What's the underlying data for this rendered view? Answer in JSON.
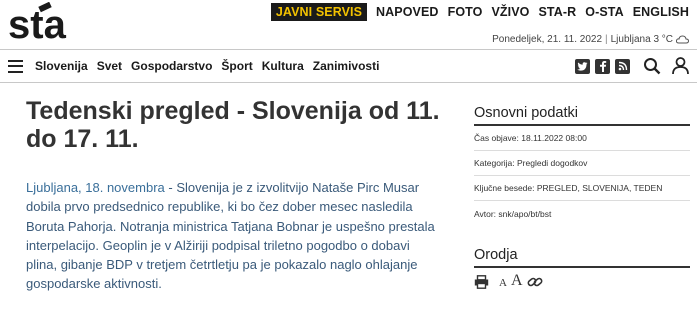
{
  "header": {
    "logo_text": "sta",
    "top_nav": [
      "JAVNI SERVIS",
      "NAPOVED",
      "FOTO",
      "VŽIVO",
      "STA-R",
      "O-STA",
      "ENGLISH"
    ],
    "date": "Ponedeljek, 21. 11. 2022",
    "weather": "Ljubljana 3 °C",
    "weather_icon": "cloud-icon"
  },
  "nav": {
    "items": [
      "Slovenija",
      "Svet",
      "Gospodarstvo",
      "Šport",
      "Kultura",
      "Zanimivosti"
    ],
    "icons": [
      "twitter-icon",
      "facebook-icon",
      "rss-icon",
      "search-icon",
      "user-icon"
    ]
  },
  "article": {
    "title": "Tedenski pregled - Slovenija od 11. do 17. 11.",
    "dateline": "Ljubljana, 18. novembra",
    "lead": " - Slovenija je z izvolitvijo Nataše Pirc Musar dobila prvo predsednico republike, ki bo čez dober mesec nasledila Boruta Pahorja. Notranja ministrica Tatjana Bobnar je uspešno prestala interpelacijo. Geoplin je v Alžiriji podpisal triletno pogodbo o dobavi plina, gibanje BDP v tretjem četrtletju pa je pokazalo naglo ohlajanje gospodarske aktivnosti."
  },
  "sidebar": {
    "basic_title": "Osnovni podatki",
    "published": "Čas objave: 18.11.2022 08:00",
    "category": "Kategorija: Pregledi dogodkov",
    "keywords": "Ključne besede: PREGLED, SLOVENIJA, TEDEN",
    "author": "Avtor: snk/apo/bt/bst",
    "tools_title": "Orodja",
    "font_small": "A",
    "font_large": "A"
  },
  "colors": {
    "accent_yellow": "#f3c200",
    "link_blue": "#3a6f9a"
  }
}
